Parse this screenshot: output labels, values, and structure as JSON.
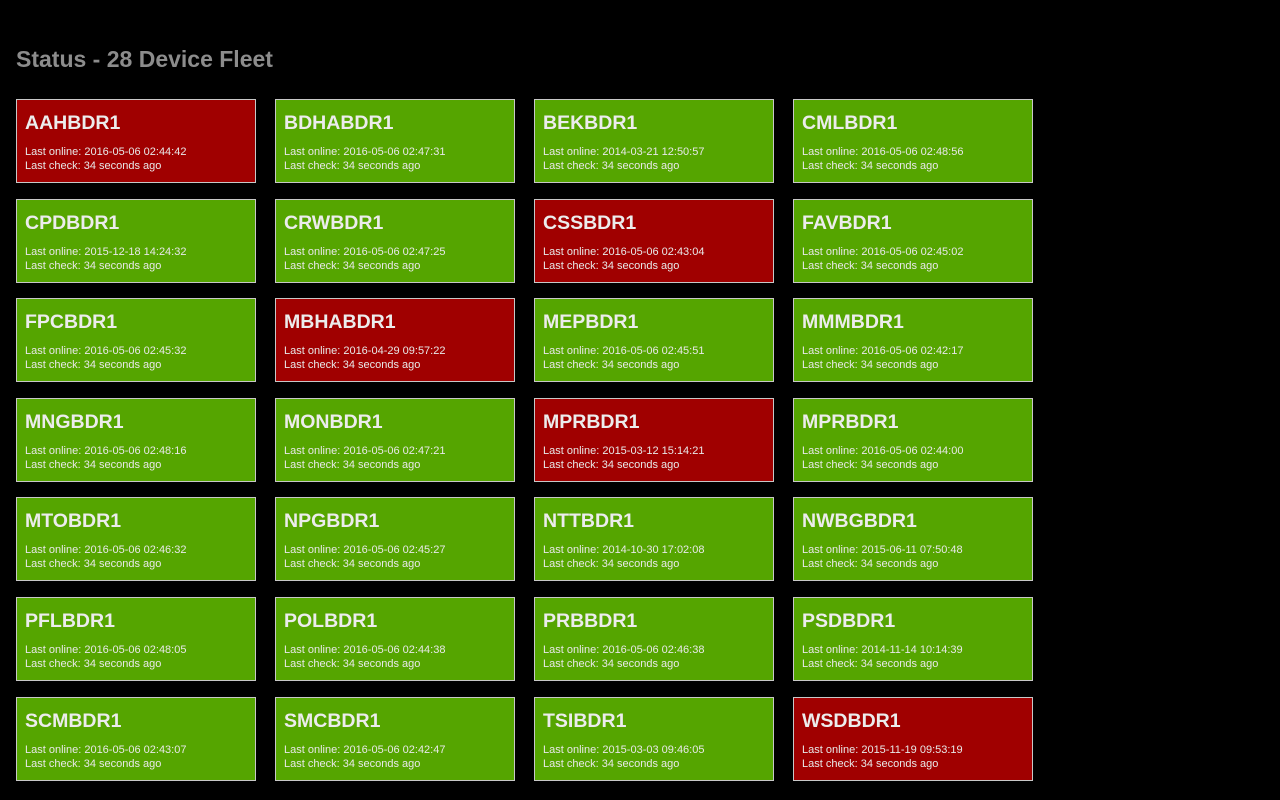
{
  "page": {
    "title": "Status - 28 Device Fleet"
  },
  "labels": {
    "last_online": "Last online: ",
    "last_check": "Last check: "
  },
  "colors": {
    "background": "#000000",
    "ok": "#55a500",
    "down": "#a00000",
    "title_text": "#8c8c8c"
  },
  "devices": [
    {
      "name": "AAHBDR1",
      "status": "down",
      "last_online": "2016-05-06 02:44:42",
      "last_check": "34 seconds ago"
    },
    {
      "name": "BDHABDR1",
      "status": "ok",
      "last_online": "2016-05-06 02:47:31",
      "last_check": "34 seconds ago"
    },
    {
      "name": "BEKBDR1",
      "status": "ok",
      "last_online": "2014-03-21 12:50:57",
      "last_check": "34 seconds ago"
    },
    {
      "name": "CMLBDR1",
      "status": "ok",
      "last_online": "2016-05-06 02:48:56",
      "last_check": "34 seconds ago"
    },
    {
      "name": "CPDBDR1",
      "status": "ok",
      "last_online": "2015-12-18 14:24:32",
      "last_check": "34 seconds ago"
    },
    {
      "name": "CRWBDR1",
      "status": "ok",
      "last_online": "2016-05-06 02:47:25",
      "last_check": "34 seconds ago"
    },
    {
      "name": "CSSBDR1",
      "status": "down",
      "last_online": "2016-05-06 02:43:04",
      "last_check": "34 seconds ago"
    },
    {
      "name": "FAVBDR1",
      "status": "ok",
      "last_online": "2016-05-06 02:45:02",
      "last_check": "34 seconds ago"
    },
    {
      "name": "FPCBDR1",
      "status": "ok",
      "last_online": "2016-05-06 02:45:32",
      "last_check": "34 seconds ago"
    },
    {
      "name": "MBHABDR1",
      "status": "down",
      "last_online": "2016-04-29 09:57:22",
      "last_check": "34 seconds ago"
    },
    {
      "name": "MEPBDR1",
      "status": "ok",
      "last_online": "2016-05-06 02:45:51",
      "last_check": "34 seconds ago"
    },
    {
      "name": "MMMBDR1",
      "status": "ok",
      "last_online": "2016-05-06 02:42:17",
      "last_check": "34 seconds ago"
    },
    {
      "name": "MNGBDR1",
      "status": "ok",
      "last_online": "2016-05-06 02:48:16",
      "last_check": "34 seconds ago"
    },
    {
      "name": "MONBDR1",
      "status": "ok",
      "last_online": "2016-05-06 02:47:21",
      "last_check": "34 seconds ago"
    },
    {
      "name": "MPRBDR1",
      "status": "down",
      "last_online": "2015-03-12 15:14:21",
      "last_check": "34 seconds ago"
    },
    {
      "name": "MPRBDR1",
      "status": "ok",
      "last_online": "2016-05-06 02:44:00",
      "last_check": "34 seconds ago"
    },
    {
      "name": "MTOBDR1",
      "status": "ok",
      "last_online": "2016-05-06 02:46:32",
      "last_check": "34 seconds ago"
    },
    {
      "name": "NPGBDR1",
      "status": "ok",
      "last_online": "2016-05-06 02:45:27",
      "last_check": "34 seconds ago"
    },
    {
      "name": "NTTBDR1",
      "status": "ok",
      "last_online": "2014-10-30 17:02:08",
      "last_check": "34 seconds ago"
    },
    {
      "name": "NWBGBDR1",
      "status": "ok",
      "last_online": "2015-06-11 07:50:48",
      "last_check": "34 seconds ago"
    },
    {
      "name": "PFLBDR1",
      "status": "ok",
      "last_online": "2016-05-06 02:48:05",
      "last_check": "34 seconds ago"
    },
    {
      "name": "POLBDR1",
      "status": "ok",
      "last_online": "2016-05-06 02:44:38",
      "last_check": "34 seconds ago"
    },
    {
      "name": "PRBBDR1",
      "status": "ok",
      "last_online": "2016-05-06 02:46:38",
      "last_check": "34 seconds ago"
    },
    {
      "name": "PSDBDR1",
      "status": "ok",
      "last_online": "2014-11-14 10:14:39",
      "last_check": "34 seconds ago"
    },
    {
      "name": "SCMBDR1",
      "status": "ok",
      "last_online": "2016-05-06 02:43:07",
      "last_check": "34 seconds ago"
    },
    {
      "name": "SMCBDR1",
      "status": "ok",
      "last_online": "2016-05-06 02:42:47",
      "last_check": "34 seconds ago"
    },
    {
      "name": "TSIBDR1",
      "status": "ok",
      "last_online": "2015-03-03 09:46:05",
      "last_check": "34 seconds ago"
    },
    {
      "name": "WSDBDR1",
      "status": "down",
      "last_online": "2015-11-19 09:53:19",
      "last_check": "34 seconds ago"
    }
  ]
}
